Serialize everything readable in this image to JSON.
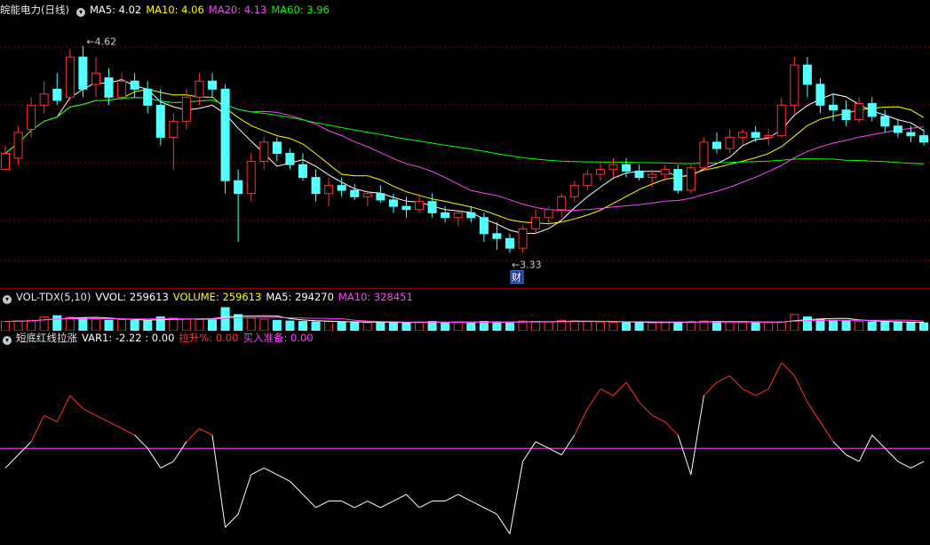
{
  "main": {
    "title": "皖能电力(日线)",
    "indicators": [
      {
        "label": "MA5: 4.02",
        "color": "#ffffff"
      },
      {
        "label": "MA10: 4.06",
        "color": "#ffff00"
      },
      {
        "label": "MA20: 4.13",
        "color": "#ff44ff"
      },
      {
        "label": "MA60: 3.96",
        "color": "#00ff00"
      }
    ],
    "high_label": "4.62",
    "low_label": "3.33",
    "event_label": "财"
  },
  "volume": {
    "title": "VOL-TDX(5,10)",
    "indicators": [
      {
        "label": "VVOL: 259613",
        "color": "#ffffff"
      },
      {
        "label": "VOLUME: 259613",
        "color": "#ffff00"
      },
      {
        "label": "MA5: 294270",
        "color": "#ffffff"
      },
      {
        "label": "MA10: 328451",
        "color": "#ff44ff"
      }
    ]
  },
  "oscillator": {
    "title": "短底红线拉涨",
    "indicators": [
      {
        "label": "VAR1: -2.22 : 0.00",
        "color": "#ffffff"
      },
      {
        "label": "拉升%: 0.00",
        "color": "#ff3333"
      },
      {
        "label": "买入准备: 0.00",
        "color": "#ff44ff"
      }
    ]
  },
  "colors": {
    "up": "#ff3232",
    "down": "#54ffff",
    "ma5": "#ffffff",
    "ma10": "#ffff00",
    "ma20": "#ff44ff",
    "ma60": "#00ff00",
    "grid": "#8b0000"
  },
  "chart_data": {
    "type": "candlestick",
    "price_range": [
      3.2,
      4.75
    ],
    "candles": [
      {
        "o": 3.85,
        "h": 4.0,
        "l": 3.84,
        "c": 3.95
      },
      {
        "o": 3.92,
        "h": 4.12,
        "l": 3.88,
        "c": 4.08
      },
      {
        "o": 4.1,
        "h": 4.3,
        "l": 4.05,
        "c": 4.25
      },
      {
        "o": 4.25,
        "h": 4.4,
        "l": 4.2,
        "c": 4.32
      },
      {
        "o": 4.35,
        "h": 4.45,
        "l": 4.25,
        "c": 4.28
      },
      {
        "o": 4.3,
        "h": 4.6,
        "l": 4.28,
        "c": 4.55
      },
      {
        "o": 4.55,
        "h": 4.62,
        "l": 4.3,
        "c": 4.35
      },
      {
        "o": 4.38,
        "h": 4.55,
        "l": 4.3,
        "c": 4.45
      },
      {
        "o": 4.42,
        "h": 4.48,
        "l": 4.25,
        "c": 4.3
      },
      {
        "o": 4.3,
        "h": 4.45,
        "l": 4.28,
        "c": 4.4
      },
      {
        "o": 4.4,
        "h": 4.45,
        "l": 4.3,
        "c": 4.35
      },
      {
        "o": 4.35,
        "h": 4.4,
        "l": 4.2,
        "c": 4.25
      },
      {
        "o": 4.25,
        "h": 4.35,
        "l": 4.0,
        "c": 4.05
      },
      {
        "o": 4.05,
        "h": 4.2,
        "l": 3.85,
        "c": 4.15
      },
      {
        "o": 4.15,
        "h": 4.35,
        "l": 4.1,
        "c": 4.3
      },
      {
        "o": 4.3,
        "h": 4.45,
        "l": 4.25,
        "c": 4.4
      },
      {
        "o": 4.4,
        "h": 4.45,
        "l": 4.3,
        "c": 4.35
      },
      {
        "o": 4.35,
        "h": 4.38,
        "l": 3.7,
        "c": 3.78
      },
      {
        "o": 3.78,
        "h": 3.85,
        "l": 3.4,
        "c": 3.7
      },
      {
        "o": 3.7,
        "h": 3.95,
        "l": 3.65,
        "c": 3.9
      },
      {
        "o": 3.9,
        "h": 4.05,
        "l": 3.85,
        "c": 4.02
      },
      {
        "o": 4.02,
        "h": 4.05,
        "l": 3.9,
        "c": 3.95
      },
      {
        "o": 3.95,
        "h": 3.98,
        "l": 3.85,
        "c": 3.88
      },
      {
        "o": 3.88,
        "h": 3.95,
        "l": 3.78,
        "c": 3.8
      },
      {
        "o": 3.8,
        "h": 3.85,
        "l": 3.65,
        "c": 3.7
      },
      {
        "o": 3.7,
        "h": 3.8,
        "l": 3.62,
        "c": 3.75
      },
      {
        "o": 3.75,
        "h": 3.8,
        "l": 3.68,
        "c": 3.72
      },
      {
        "o": 3.72,
        "h": 3.76,
        "l": 3.66,
        "c": 3.68
      },
      {
        "o": 3.68,
        "h": 3.72,
        "l": 3.62,
        "c": 3.7
      },
      {
        "o": 3.7,
        "h": 3.75,
        "l": 3.64,
        "c": 3.66
      },
      {
        "o": 3.66,
        "h": 3.7,
        "l": 3.58,
        "c": 3.62
      },
      {
        "o": 3.62,
        "h": 3.68,
        "l": 3.55,
        "c": 3.6
      },
      {
        "o": 3.6,
        "h": 3.7,
        "l": 3.58,
        "c": 3.65
      },
      {
        "o": 3.65,
        "h": 3.7,
        "l": 3.55,
        "c": 3.58
      },
      {
        "o": 3.58,
        "h": 3.62,
        "l": 3.52,
        "c": 3.55
      },
      {
        "o": 3.55,
        "h": 3.6,
        "l": 3.5,
        "c": 3.58
      },
      {
        "o": 3.58,
        "h": 3.62,
        "l": 3.52,
        "c": 3.55
      },
      {
        "o": 3.55,
        "h": 3.58,
        "l": 3.4,
        "c": 3.45
      },
      {
        "o": 3.45,
        "h": 3.52,
        "l": 3.35,
        "c": 3.42
      },
      {
        "o": 3.42,
        "h": 3.45,
        "l": 3.33,
        "c": 3.36
      },
      {
        "o": 3.36,
        "h": 3.5,
        "l": 3.33,
        "c": 3.48
      },
      {
        "o": 3.48,
        "h": 3.6,
        "l": 3.45,
        "c": 3.55
      },
      {
        "o": 3.55,
        "h": 3.62,
        "l": 3.5,
        "c": 3.6
      },
      {
        "o": 3.6,
        "h": 3.7,
        "l": 3.55,
        "c": 3.68
      },
      {
        "o": 3.68,
        "h": 3.78,
        "l": 3.65,
        "c": 3.75
      },
      {
        "o": 3.75,
        "h": 3.85,
        "l": 3.72,
        "c": 3.82
      },
      {
        "o": 3.82,
        "h": 3.9,
        "l": 3.78,
        "c": 3.85
      },
      {
        "o": 3.85,
        "h": 3.92,
        "l": 3.8,
        "c": 3.88
      },
      {
        "o": 3.88,
        "h": 3.92,
        "l": 3.8,
        "c": 3.84
      },
      {
        "o": 3.84,
        "h": 3.88,
        "l": 3.78,
        "c": 3.8
      },
      {
        "o": 3.8,
        "h": 3.85,
        "l": 3.74,
        "c": 3.82
      },
      {
        "o": 3.82,
        "h": 3.88,
        "l": 3.78,
        "c": 3.85
      },
      {
        "o": 3.85,
        "h": 3.88,
        "l": 3.7,
        "c": 3.72
      },
      {
        "o": 3.72,
        "h": 3.88,
        "l": 3.7,
        "c": 3.86
      },
      {
        "o": 3.86,
        "h": 4.05,
        "l": 3.84,
        "c": 4.02
      },
      {
        "o": 4.02,
        "h": 4.08,
        "l": 3.95,
        "c": 3.98
      },
      {
        "o": 3.98,
        "h": 4.1,
        "l": 3.95,
        "c": 4.05
      },
      {
        "o": 4.05,
        "h": 4.1,
        "l": 4.0,
        "c": 4.08
      },
      {
        "o": 4.08,
        "h": 4.12,
        "l": 4.02,
        "c": 4.05
      },
      {
        "o": 4.05,
        "h": 4.1,
        "l": 4.0,
        "c": 4.06
      },
      {
        "o": 4.06,
        "h": 4.3,
        "l": 4.05,
        "c": 4.25
      },
      {
        "o": 4.25,
        "h": 4.55,
        "l": 4.2,
        "c": 4.5
      },
      {
        "o": 4.5,
        "h": 4.55,
        "l": 4.3,
        "c": 4.38
      },
      {
        "o": 4.38,
        "h": 4.42,
        "l": 4.2,
        "c": 4.25
      },
      {
        "o": 4.25,
        "h": 4.32,
        "l": 4.15,
        "c": 4.22
      },
      {
        "o": 4.22,
        "h": 4.28,
        "l": 4.12,
        "c": 4.16
      },
      {
        "o": 4.16,
        "h": 4.3,
        "l": 4.14,
        "c": 4.26
      },
      {
        "o": 4.26,
        "h": 4.3,
        "l": 4.15,
        "c": 4.18
      },
      {
        "o": 4.18,
        "h": 4.22,
        "l": 4.08,
        "c": 4.12
      },
      {
        "o": 4.12,
        "h": 4.16,
        "l": 4.05,
        "c": 4.08
      },
      {
        "o": 4.08,
        "h": 4.12,
        "l": 4.02,
        "c": 4.06
      },
      {
        "o": 4.06,
        "h": 4.1,
        "l": 4.0,
        "c": 4.02
      }
    ],
    "volume": [
      40,
      42,
      45,
      60,
      65,
      58,
      55,
      50,
      45,
      48,
      44,
      42,
      60,
      55,
      50,
      48,
      46,
      100,
      70,
      55,
      50,
      45,
      42,
      40,
      38,
      40,
      38,
      36,
      35,
      37,
      36,
      35,
      38,
      40,
      36,
      37,
      35,
      40,
      38,
      36,
      42,
      40,
      38,
      45,
      42,
      40,
      38,
      36,
      37,
      35,
      34,
      36,
      38,
      40,
      42,
      40,
      38,
      37,
      36,
      35,
      38,
      70,
      60,
      50,
      45,
      42,
      40,
      38,
      37,
      36,
      35,
      34
    ],
    "var1": [
      -0.3,
      -0.1,
      0.1,
      0.5,
      0.4,
      0.8,
      0.6,
      0.5,
      0.4,
      0.3,
      0.2,
      0.0,
      -0.3,
      -0.2,
      0.1,
      0.3,
      0.2,
      -1.2,
      -1.0,
      -0.4,
      -0.3,
      -0.4,
      -0.5,
      -0.7,
      -0.9,
      -0.8,
      -0.8,
      -0.9,
      -0.8,
      -0.9,
      -0.8,
      -0.7,
      -0.9,
      -0.8,
      -0.8,
      -0.7,
      -0.8,
      -0.9,
      -1.0,
      -1.3,
      -0.2,
      0.1,
      0.0,
      -0.1,
      0.2,
      0.6,
      0.9,
      0.8,
      1.0,
      0.7,
      0.5,
      0.4,
      0.2,
      -0.4,
      0.8,
      1.0,
      1.1,
      0.9,
      0.8,
      0.9,
      1.3,
      1.1,
      0.7,
      0.4,
      0.1,
      -0.1,
      -0.2,
      0.2,
      0.0,
      -0.2,
      -0.3,
      -0.2
    ]
  }
}
